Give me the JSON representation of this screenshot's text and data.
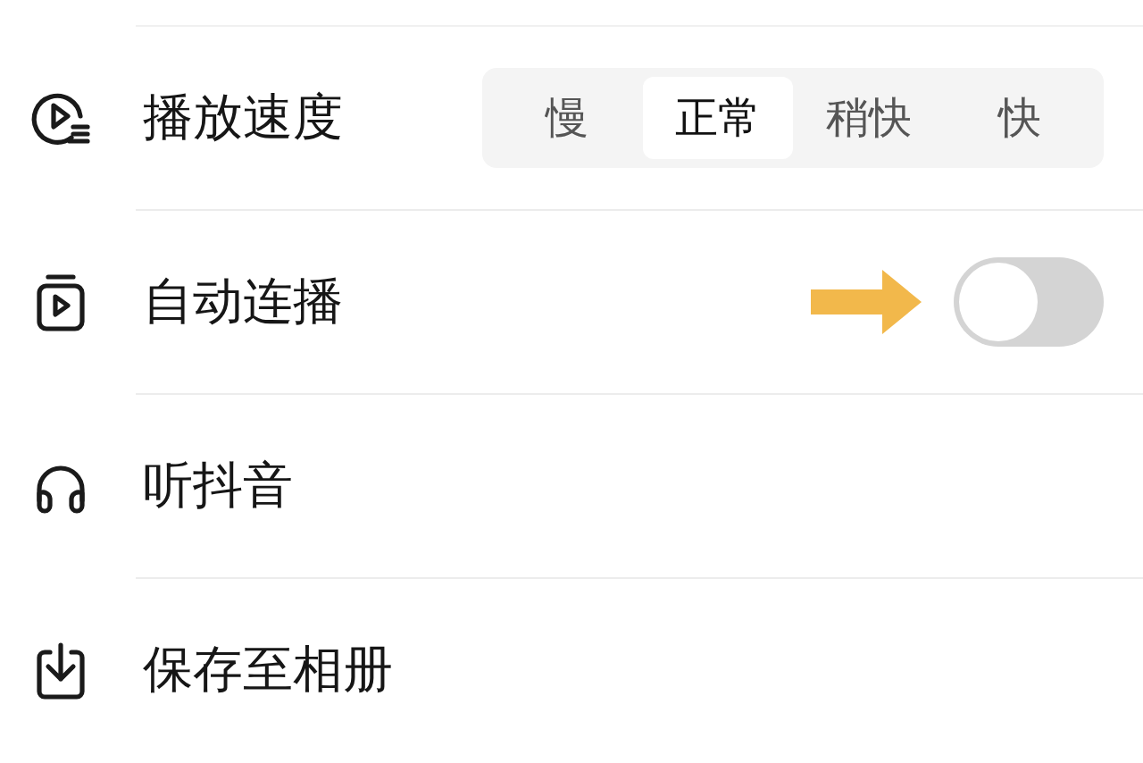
{
  "settings": [
    {
      "kind": "segments",
      "label": "播放速度",
      "options": [
        {
          "label": "慢",
          "selected": false
        },
        {
          "label": "正常",
          "selected": true
        },
        {
          "label": "稍快",
          "selected": false
        },
        {
          "label": "快",
          "selected": false
        }
      ]
    },
    {
      "kind": "toggle",
      "label": "自动连播",
      "on": false,
      "pointer": true
    },
    {
      "kind": "plain",
      "label": "听抖音"
    },
    {
      "kind": "plain",
      "label": "保存至相册"
    }
  ]
}
